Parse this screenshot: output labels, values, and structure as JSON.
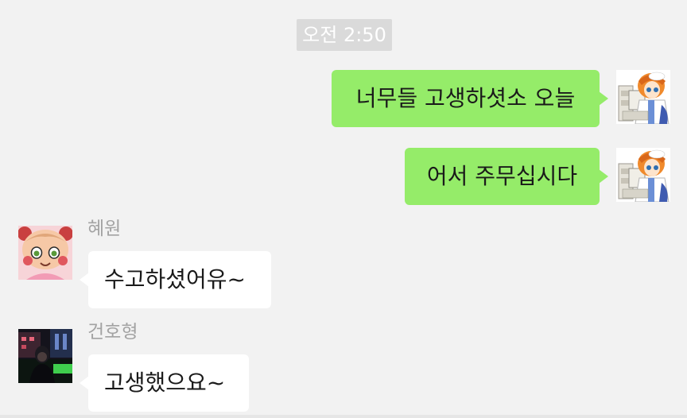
{
  "chat": {
    "timestamp": "오전 2:50",
    "messages": [
      {
        "text": "너무들 고생하셧소 오늘"
      },
      {
        "text": "어서 주무십시다"
      },
      {
        "sender": "혜원",
        "text": "수고하셨어유~"
      },
      {
        "sender": "건호형",
        "text": "고생했으요~"
      }
    ]
  },
  "colors": {
    "background": "#f2f2f2",
    "outgoing_bubble": "#95ec69",
    "incoming_bubble": "#ffffff",
    "timestamp_badge": "#dadada",
    "sender_name": "#a3a3a3"
  },
  "icons": {
    "own_avatar": "anime-doctor-avatar",
    "hyewon_avatar": "cartoon-girl-avatar",
    "geonho_avatar": "night-photo-avatar"
  }
}
